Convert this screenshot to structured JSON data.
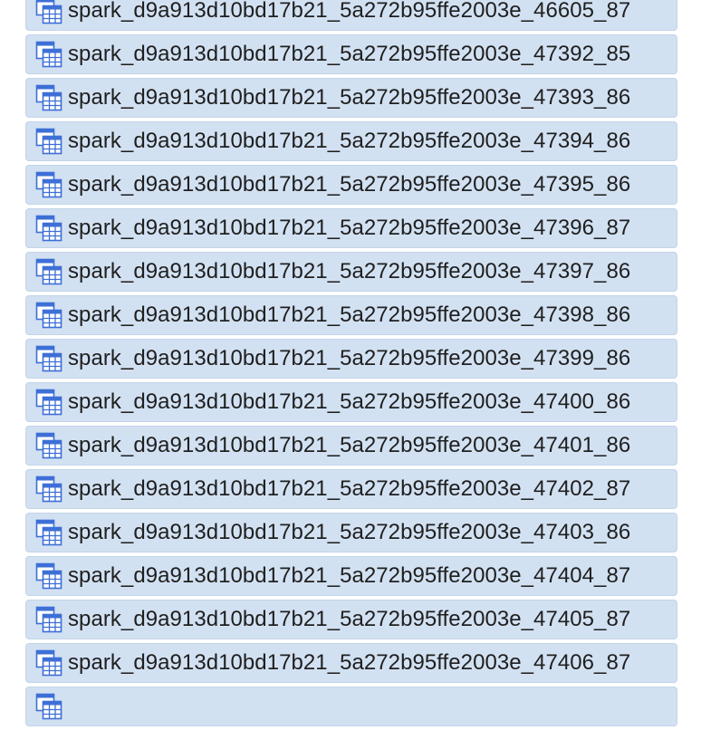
{
  "theme": {
    "row_bg": "#d2e1f2",
    "row_border": "#c3d4e9",
    "icon_color": "#3d6fd6",
    "text_color": "#1f1f1f"
  },
  "list": {
    "item_icon": "table-icon",
    "items": [
      {
        "label": "spark_d9a913d10bd17b21_5a272b95ffe2003e_46605_87"
      },
      {
        "label": "spark_d9a913d10bd17b21_5a272b95ffe2003e_47392_85"
      },
      {
        "label": "spark_d9a913d10bd17b21_5a272b95ffe2003e_47393_86"
      },
      {
        "label": "spark_d9a913d10bd17b21_5a272b95ffe2003e_47394_86"
      },
      {
        "label": "spark_d9a913d10bd17b21_5a272b95ffe2003e_47395_86"
      },
      {
        "label": "spark_d9a913d10bd17b21_5a272b95ffe2003e_47396_87"
      },
      {
        "label": "spark_d9a913d10bd17b21_5a272b95ffe2003e_47397_86"
      },
      {
        "label": "spark_d9a913d10bd17b21_5a272b95ffe2003e_47398_86"
      },
      {
        "label": "spark_d9a913d10bd17b21_5a272b95ffe2003e_47399_86"
      },
      {
        "label": "spark_d9a913d10bd17b21_5a272b95ffe2003e_47400_86"
      },
      {
        "label": "spark_d9a913d10bd17b21_5a272b95ffe2003e_47401_86"
      },
      {
        "label": "spark_d9a913d10bd17b21_5a272b95ffe2003e_47402_87"
      },
      {
        "label": "spark_d9a913d10bd17b21_5a272b95ffe2003e_47403_86"
      },
      {
        "label": "spark_d9a913d10bd17b21_5a272b95ffe2003e_47404_87"
      },
      {
        "label": "spark_d9a913d10bd17b21_5a272b95ffe2003e_47405_87"
      },
      {
        "label": "spark_d9a913d10bd17b21_5a272b95ffe2003e_47406_87"
      }
    ]
  }
}
